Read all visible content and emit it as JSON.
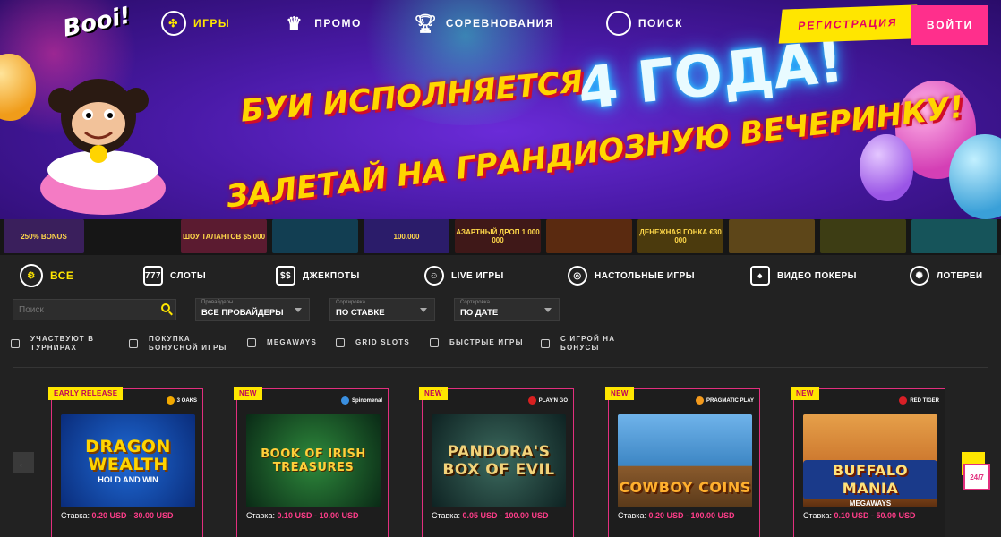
{
  "brand": {
    "logo": "Booi!"
  },
  "nav": {
    "items": [
      {
        "label": "ИГРЫ",
        "icon": "games-icon",
        "active": true
      },
      {
        "label": "ПРОМО",
        "icon": "crown-icon",
        "active": false
      },
      {
        "label": "СОРЕВНОВАНИЯ",
        "icon": "trophy-icon",
        "active": false
      },
      {
        "label": "ПОИСК",
        "icon": "search-icon",
        "active": false
      }
    ],
    "register_label": "РЕГИСТРАЦИЯ",
    "login_label": "ВОЙТИ"
  },
  "hero": {
    "neon_text": "4 ГОДА!",
    "line1": "БУИ ИСПОЛНЯЕТСЯ",
    "line2": "ЗАЛЕТАЙ НА ГРАНДИОЗНУЮ ВЕЧЕРИНКУ!"
  },
  "strip": {
    "tiles": [
      {
        "text": "250% BONUS",
        "color": "#3a1f5c"
      },
      {
        "text": "ШОУ ТАЛАНТОВ $5 000",
        "color": "#5b1b30"
      },
      {
        "text": "",
        "color": "#123e52"
      },
      {
        "text": "100.000",
        "color": "#2b1c6a"
      },
      {
        "text": "АЗАРТНЫЙ ДРОП 1 000 000",
        "color": "#3f1818"
      },
      {
        "text": "",
        "color": "#5a2a10"
      },
      {
        "text": "ДЕНЕЖНАЯ ГОНКА €30 000",
        "color": "#4b3a0d"
      },
      {
        "text": "",
        "color": "#5d4619"
      },
      {
        "text": "",
        "color": "#3d3d14"
      },
      {
        "text": "",
        "color": "#16545a"
      },
      {
        "text": "",
        "color": "#1c4554"
      }
    ]
  },
  "categories": [
    {
      "label": "ВСЕ",
      "icon": "all-icon",
      "active": true
    },
    {
      "label": "СЛОТЫ",
      "icon": "slots-icon",
      "active": false
    },
    {
      "label": "ДЖЕКПОТЫ",
      "icon": "jackpot-icon",
      "active": false
    },
    {
      "label": "LIVE ИГРЫ",
      "icon": "live-dealer-icon",
      "active": false
    },
    {
      "label": "НАСТОЛЬНЫЕ ИГРЫ",
      "icon": "table-games-icon",
      "active": false
    },
    {
      "label": "ВИДЕО ПОКЕРЫ",
      "icon": "video-poker-icon",
      "active": false
    },
    {
      "label": "ЛОТЕРЕИ",
      "icon": "lottery-icon",
      "active": false
    }
  ],
  "filters": {
    "search_placeholder": "Поиск",
    "providers": {
      "label": "Провайдеры",
      "value": "ВСЕ ПРОВАЙДЕРЫ"
    },
    "sort1": {
      "label": "Сортировка",
      "value": "ПО СТАВКЕ"
    },
    "sort2": {
      "label": "Сортировка",
      "value": "ПО ДАТЕ"
    },
    "checkboxes": [
      {
        "line1": "УЧАСТВУЮТ В",
        "line2": "ТУРНИРАХ"
      },
      {
        "line1": "ПОКУПКА",
        "line2": "БОНУСНОЙ ИГРЫ"
      },
      {
        "line1": "MEGAWAYS",
        "line2": ""
      },
      {
        "line1": "GRID SLOTS",
        "line2": ""
      },
      {
        "line1": "БЫСТРЫЕ ИГРЫ",
        "line2": ""
      },
      {
        "line1": "С ИГРОЙ НА",
        "line2": "БОНУСЫ"
      }
    ]
  },
  "games": [
    {
      "badge": "EARLY RELEASE",
      "provider": "3 OAKS",
      "title": "DRAGON WEALTH",
      "subtitle": "HOLD AND WIN",
      "bet_label": "Ставка:",
      "bet_range": "0.20 USD - 30.00 USD",
      "bg": "#0c3c9a",
      "fg": "#ffd400",
      "dot": "#f2a900"
    },
    {
      "badge": "NEW",
      "provider": "Spinomenal",
      "title": "BOOK OF IRISH TREASURES",
      "subtitle": "",
      "bet_label": "Ставка:",
      "bet_range": "0.10 USD - 10.00 USD",
      "bg": "#0f4a2a",
      "fg": "#ffcf3a",
      "dot": "#3a8fe0"
    },
    {
      "badge": "NEW",
      "provider": "PLAY'N GO",
      "title": "PANDORA'S BOX OF EVIL",
      "subtitle": "",
      "bet_label": "Ставка:",
      "bet_range": "0.05 USD - 100.00 USD",
      "bg": "#183a3a",
      "fg": "#f2d37a",
      "dot": "#d82020"
    },
    {
      "badge": "NEW",
      "provider": "PRAGMATIC PLAY",
      "title": "COWBOY COINS",
      "subtitle": "",
      "bet_label": "Ставка:",
      "bet_range": "0.20 USD - 100.00 USD",
      "bg": "#3d86c4",
      "fg": "#ffb02e",
      "dot": "#f39a1d"
    },
    {
      "badge": "NEW",
      "provider": "RED TIGER",
      "title": "BUFFALO MANIA",
      "subtitle": "MEGAWAYS",
      "bet_label": "Ставка:",
      "bet_range": "0.10 USD - 50.00 USD",
      "bg": "#c9722a",
      "fg": "#ffe27a",
      "dot": "#d81f26"
    }
  ],
  "support": {
    "label": "24/7"
  }
}
